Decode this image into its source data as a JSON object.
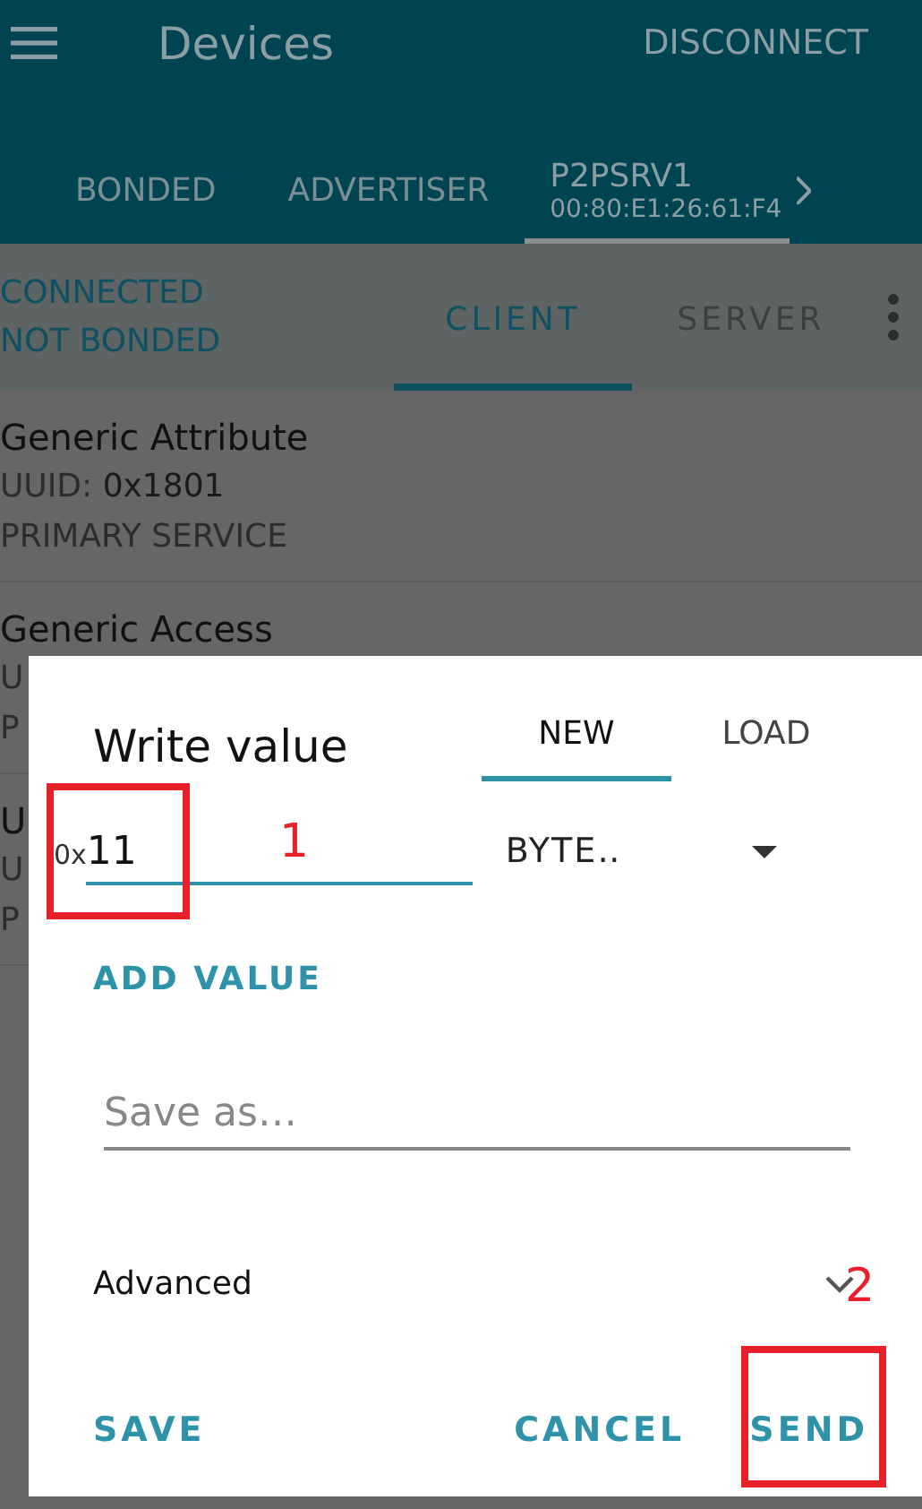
{
  "app_bar": {
    "title": "Devices",
    "action": "DISCONNECT"
  },
  "device_tabs": [
    {
      "label": "BONDED",
      "selected": false
    },
    {
      "label": "ADVERTISER",
      "selected": false
    },
    {
      "label": "P2PSRV1",
      "address": "00:80:E1:26:61:F4",
      "selected": true
    }
  ],
  "status": {
    "connection": "CONNECTED",
    "bonding": "NOT BONDED"
  },
  "role_tabs": [
    {
      "label": "CLIENT",
      "selected": true
    },
    {
      "label": "SERVER",
      "selected": false
    }
  ],
  "services": [
    {
      "name": "Generic Attribute",
      "uuid_label": "UUID:",
      "uuid_value": "0x1801",
      "type": "PRIMARY SERVICE"
    },
    {
      "name": "Generic Access",
      "uuid_label": "U",
      "type": "P"
    },
    {
      "name": "U",
      "uuid_label": "U",
      "type": "P"
    }
  ],
  "dialog": {
    "title": "Write value",
    "tabs": [
      {
        "label": "NEW",
        "selected": true
      },
      {
        "label": "LOAD",
        "selected": false
      }
    ],
    "prefix": "0x",
    "value": "11",
    "format": "BYTE‥",
    "add_button": "ADD VALUE",
    "save_as_placeholder": "Save as…",
    "advanced": {
      "label": "Advanced",
      "expanded": false
    },
    "buttons": [
      "SAVE",
      "CANCEL",
      "SEND"
    ]
  },
  "callouts": [
    {
      "label": "1"
    },
    {
      "label": "2"
    }
  ]
}
